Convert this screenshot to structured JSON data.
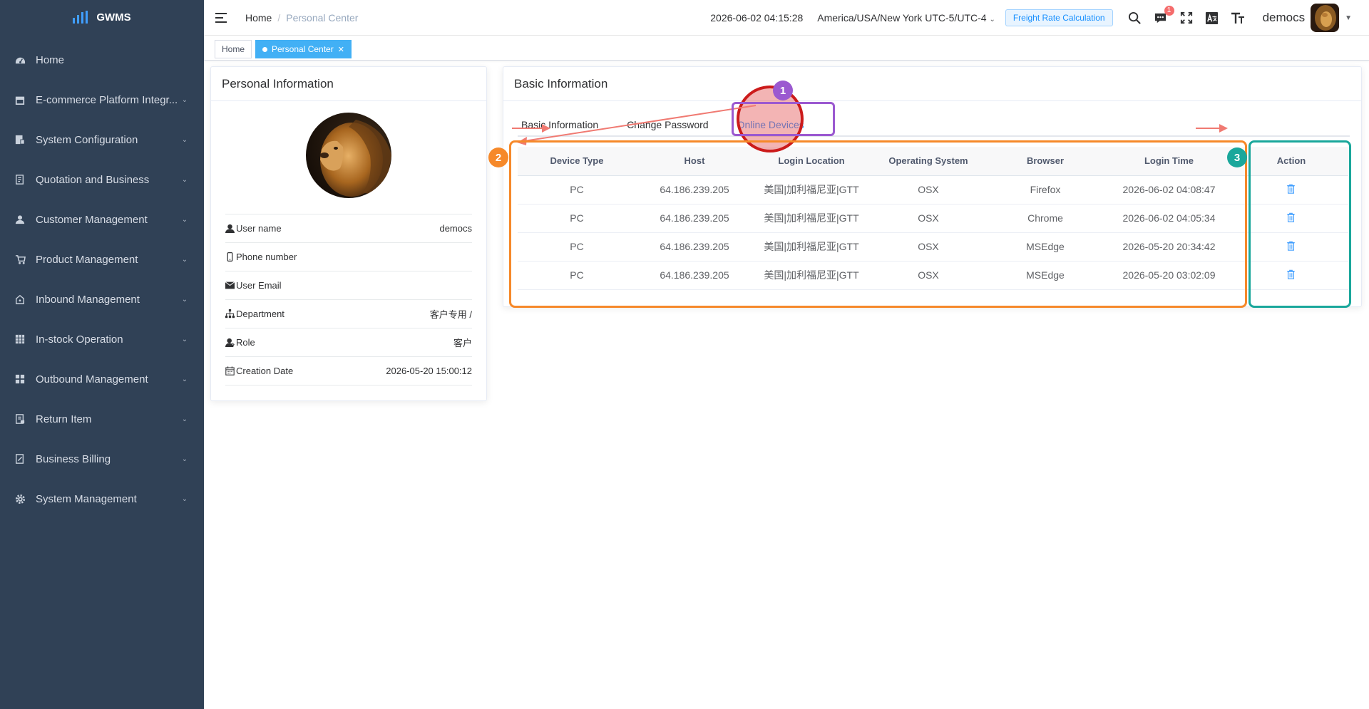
{
  "app": {
    "name": "GWMS"
  },
  "sidebar": {
    "items": [
      {
        "label": "Home",
        "icon": "dashboard-icon",
        "expandable": false
      },
      {
        "label": "E-commerce Platform Integr...",
        "icon": "store-icon",
        "expandable": true
      },
      {
        "label": "System Configuration",
        "icon": "config-icon",
        "expandable": true
      },
      {
        "label": "Quotation and Business",
        "icon": "document-icon",
        "expandable": true
      },
      {
        "label": "Customer Management",
        "icon": "user-icon",
        "expandable": true
      },
      {
        "label": "Product Management",
        "icon": "cart-icon",
        "expandable": true
      },
      {
        "label": "Inbound Management",
        "icon": "house-icon",
        "expandable": true
      },
      {
        "label": "In-stock Operation",
        "icon": "grid-icon",
        "expandable": true
      },
      {
        "label": "Outbound Management",
        "icon": "tiles-icon",
        "expandable": true
      },
      {
        "label": "Return Item",
        "icon": "return-doc-icon",
        "expandable": true
      },
      {
        "label": "Business Billing",
        "icon": "billing-icon",
        "expandable": true
      },
      {
        "label": "System Management",
        "icon": "gear-icon",
        "expandable": true
      }
    ]
  },
  "header": {
    "breadcrumb": [
      "Home",
      "Personal Center"
    ],
    "datetime": "2026-06-02 04:15:28",
    "timezone": "America/USA/New York UTC-5/UTC-4",
    "freight_button": "Freight Rate Calculation",
    "message_badge": "1",
    "username": "democs"
  },
  "tags": [
    {
      "label": "Home",
      "active": false
    },
    {
      "label": "Personal Center",
      "active": true
    }
  ],
  "personal": {
    "title": "Personal Information",
    "rows": [
      {
        "label": "User name",
        "value": "democs",
        "icon": "user-icon"
      },
      {
        "label": "Phone number",
        "value": "",
        "icon": "phone-icon"
      },
      {
        "label": "User Email",
        "value": "",
        "icon": "mail-icon"
      },
      {
        "label": "Department",
        "value": "客户专用 /",
        "icon": "org-tree-icon"
      },
      {
        "label": "Role",
        "value": "客户",
        "icon": "role-icon"
      },
      {
        "label": "Creation Date",
        "value": "2026-05-20 15:00:12",
        "icon": "calendar-icon"
      }
    ]
  },
  "basic": {
    "title": "Basic Information",
    "tabs": [
      "Basic Information",
      "Change Password",
      "Online Devices"
    ],
    "active_tab": 2,
    "columns": [
      "Device Type",
      "Host",
      "Login Location",
      "Operating System",
      "Browser",
      "Login Time",
      "Action"
    ],
    "rows": [
      [
        "PC",
        "64.186.239.205",
        "美国|加利福尼亚|GTT",
        "OSX",
        "Firefox",
        "2026-06-02 04:08:47"
      ],
      [
        "PC",
        "64.186.239.205",
        "美国|加利福尼亚|GTT",
        "OSX",
        "Chrome",
        "2026-06-02 04:05:34"
      ],
      [
        "PC",
        "64.186.239.205",
        "美国|加利福尼亚|GTT",
        "OSX",
        "MSEdge",
        "2026-05-20 20:34:42"
      ],
      [
        "PC",
        "64.186.239.205",
        "美国|加利福尼亚|GTT",
        "OSX",
        "MSEdge",
        "2026-05-20 03:02:09"
      ]
    ]
  },
  "annotations": {
    "steps": [
      "1",
      "2",
      "3"
    ],
    "colors": {
      "step1": "#9b59d0",
      "step2": "#f6892a",
      "step3": "#1aa79b",
      "click": "#cc1b1b",
      "arrow": "#f07a72"
    }
  }
}
